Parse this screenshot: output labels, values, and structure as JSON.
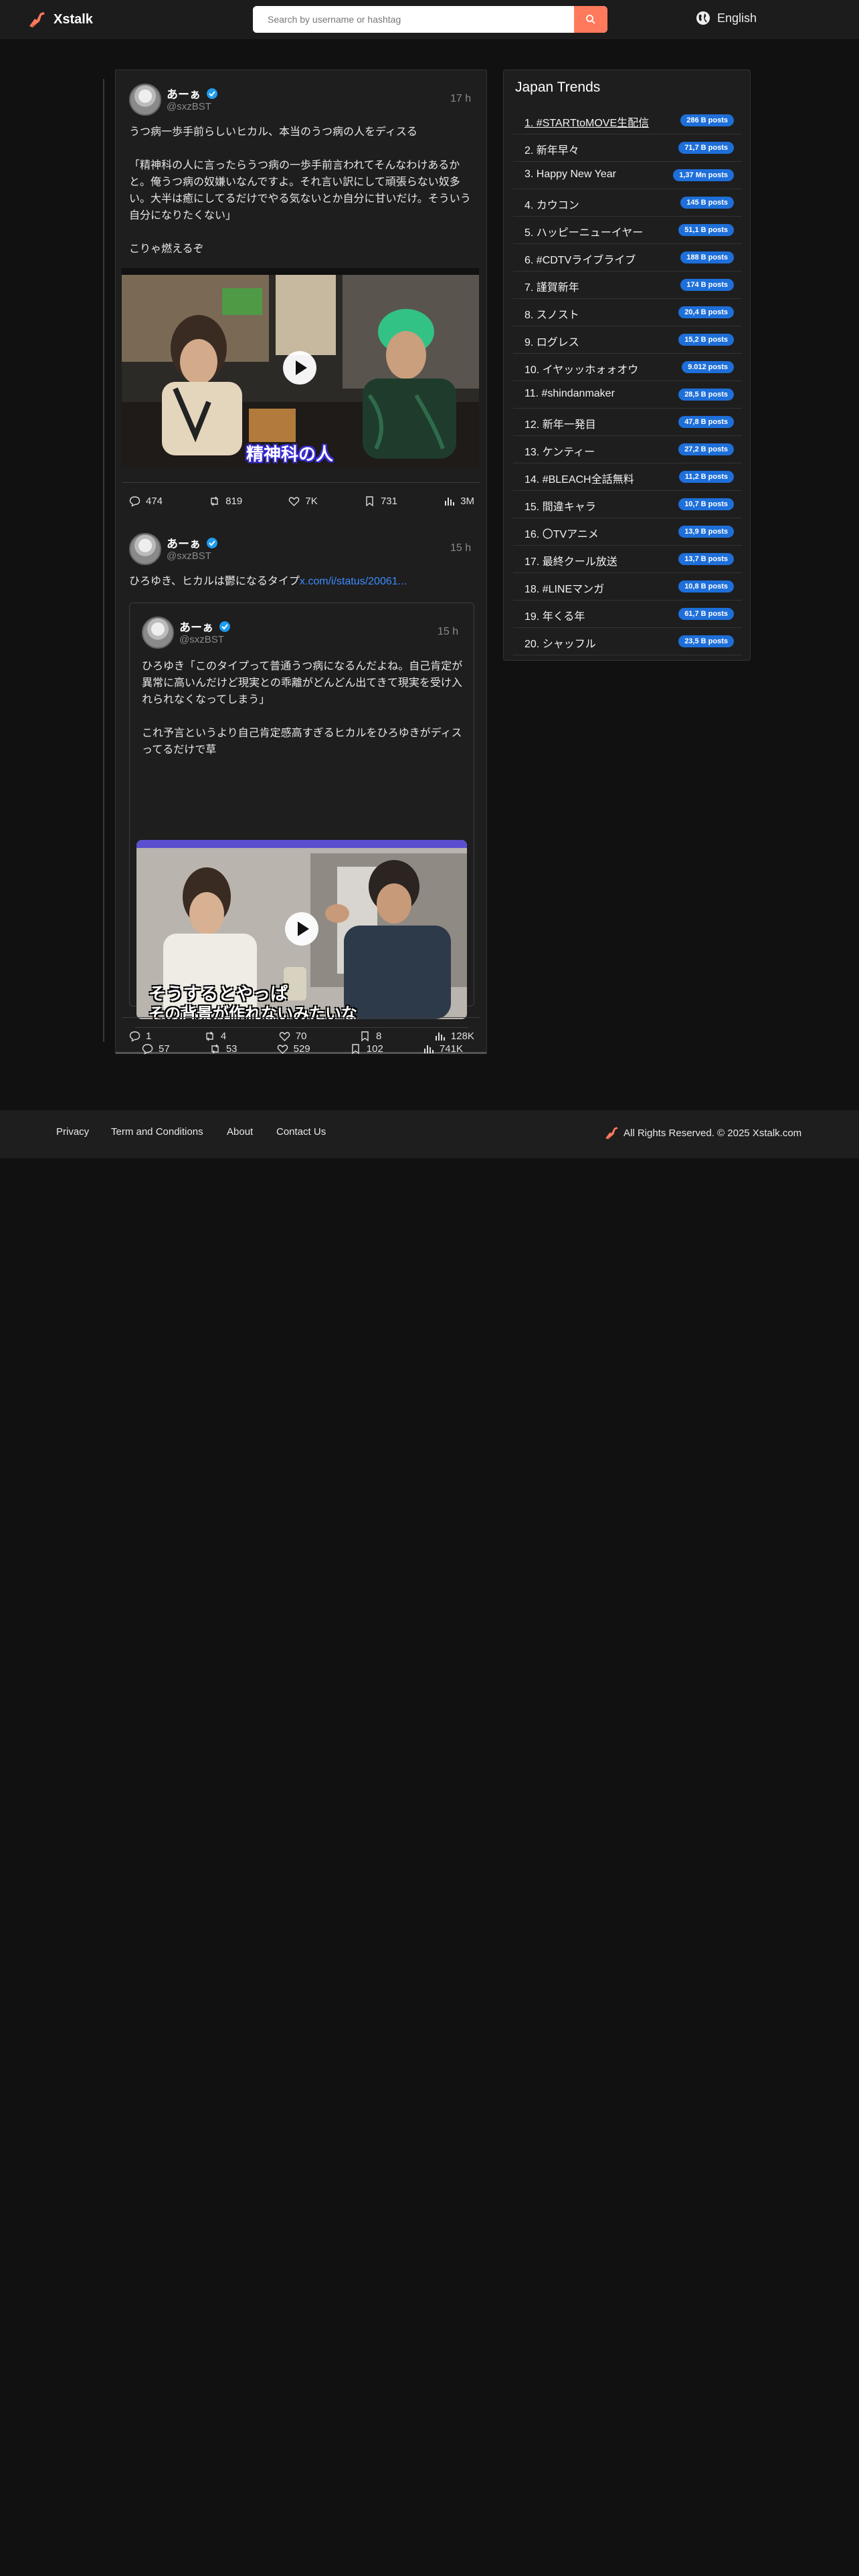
{
  "header": {
    "brand": "Xstalk",
    "search_placeholder": "Search by username or hashtag",
    "language": "English"
  },
  "posts": [
    {
      "author": "あーぁ",
      "handle": "@sxzBST",
      "time": "17 h",
      "text": "うつ病一歩手前らしいヒカル、本当のうつ病の人をディスる\n\n「精神科の人に言ったらうつ病の一歩手前言われてそんなわけあるかと。俺うつ病の奴嫌いなんですよ。それ言い訳にして頑張らない奴多い。大半は癒にしてるだけでやる気ないとか自分に甘いだけ。そういう自分になりたくない」\n\nこりゃ燃えるぞ",
      "video_caption": "精神科の人",
      "stats": {
        "replies": "474",
        "reposts": "819",
        "likes": "7K",
        "bookmarks": "731",
        "views": "3M"
      }
    },
    {
      "author": "あーぁ",
      "handle": "@sxzBST",
      "time": "15 h",
      "text_prefix": "ひろゆき、ヒカルは鬱になるタイプ",
      "link": "x.com/i/status/20061...",
      "quote": {
        "author": "あーぁ",
        "handle": "@sxzBST",
        "time": "15 h",
        "text": "ひろゆき「このタイプって普通うつ病になるんだよね。自己肯定が異常に高いんだけど現実との乖離がどんどん出てきて現実を受け入れられなくなってしまう」\n\nこれ予言というより自己肯定感高すぎるヒカルをひろゆきがディスってるだけで草",
        "video_caption": "そうするとやっぱ",
        "video_caption2": "その背景が作れないみたいな",
        "stats": {
          "replies": "57",
          "reposts": "53",
          "likes": "529",
          "bookmarks": "102",
          "views": "741K"
        }
      },
      "stats": {
        "replies": "1",
        "reposts": "4",
        "likes": "70",
        "bookmarks": "8",
        "views": "128K"
      }
    }
  ],
  "trends": {
    "title": "Japan Trends",
    "items": [
      {
        "name": "1. #STARTtoMOVE生配信",
        "posts": "286 B posts"
      },
      {
        "name": "2. 新年早々",
        "posts": "71,7 B posts"
      },
      {
        "name": "3. Happy New Year",
        "posts": "1,37 Mn posts"
      },
      {
        "name": "4. カウコン",
        "posts": "145 B posts"
      },
      {
        "name": "5. ハッピーニューイヤー",
        "posts": "51,1 B posts"
      },
      {
        "name": "6. #CDTVライブライブ",
        "posts": "188 B posts"
      },
      {
        "name": "7. 謹賀新年",
        "posts": "174 B posts"
      },
      {
        "name": "8. スノスト",
        "posts": "20,4 B posts"
      },
      {
        "name": "9. ログレス",
        "posts": "15,2 B posts"
      },
      {
        "name": "10. イヤッッホォォオウ",
        "posts": "9.012 posts"
      },
      {
        "name": "11. #shindanmaker",
        "posts": "28,5 B posts"
      },
      {
        "name": "12. 新年一発目",
        "posts": "47,8 B posts"
      },
      {
        "name": "13. ケンティー",
        "posts": "27,2 B posts"
      },
      {
        "name": "14. #BLEACH全話無料",
        "posts": "11,2 B posts"
      },
      {
        "name": "15. 間違キャラ",
        "posts": "10,7 B posts"
      },
      {
        "name": "16. 〇TVアニメ",
        "posts": "13,9 B posts"
      },
      {
        "name": "17. 最終クール放送",
        "posts": "13,7 B posts"
      },
      {
        "name": "18. #LINEマンガ",
        "posts": "10,8 B posts"
      },
      {
        "name": "19. 年くる年",
        "posts": "61,7 B posts"
      },
      {
        "name": "20. シャッフル",
        "posts": "23,5 B posts"
      }
    ]
  },
  "footer": {
    "links": [
      "Privacy",
      "Term and Conditions",
      "About",
      "Contact Us"
    ],
    "copyright": "All Rights Reserved. © 2025 Xstalk.com"
  },
  "colors": {
    "accent": "#ff7a5c",
    "link": "#3d8bff",
    "pill": "#1e6fd9",
    "verified": "#1d9bf0"
  }
}
